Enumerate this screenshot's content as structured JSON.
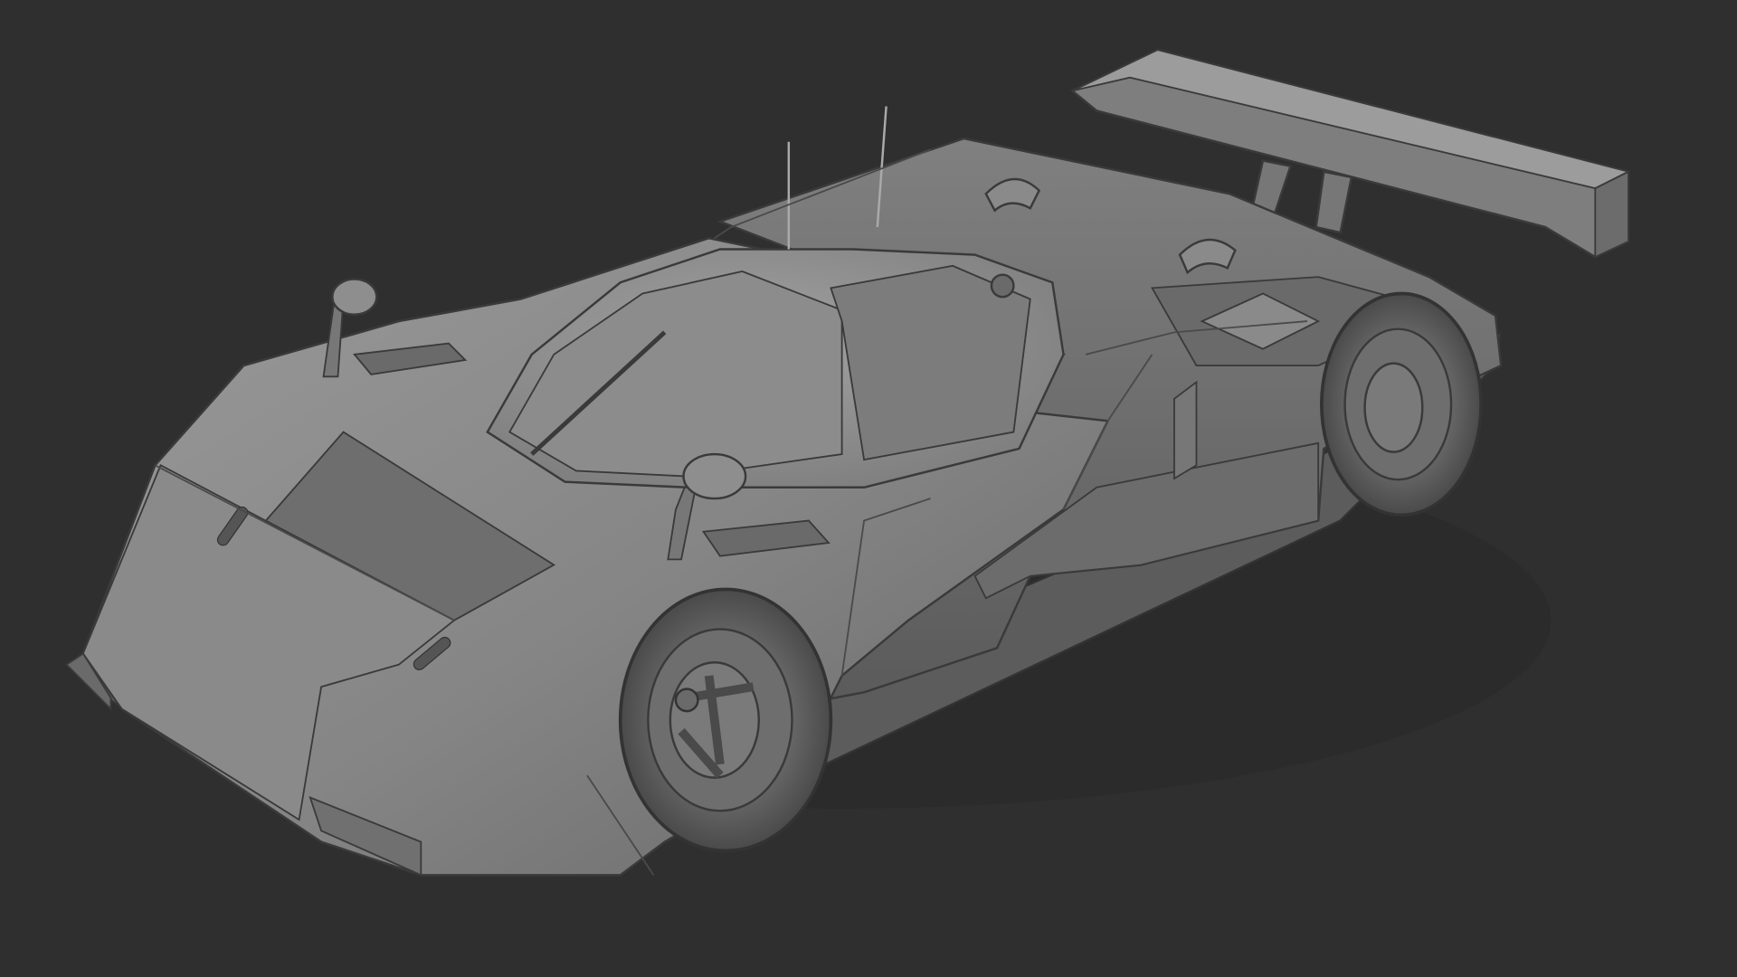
{
  "viewport": {
    "background": "#2f2f2f",
    "render_mode": "clay-shaded-3d-model",
    "subject": "racing-car-model"
  },
  "palette": {
    "body_light": "#8e8e8e",
    "body_mid": "#7a7a7a",
    "body_dark": "#5e5e5e",
    "shadow": "#444444",
    "edge": "#3a3a3a",
    "highlight": "#a6a6a6"
  }
}
